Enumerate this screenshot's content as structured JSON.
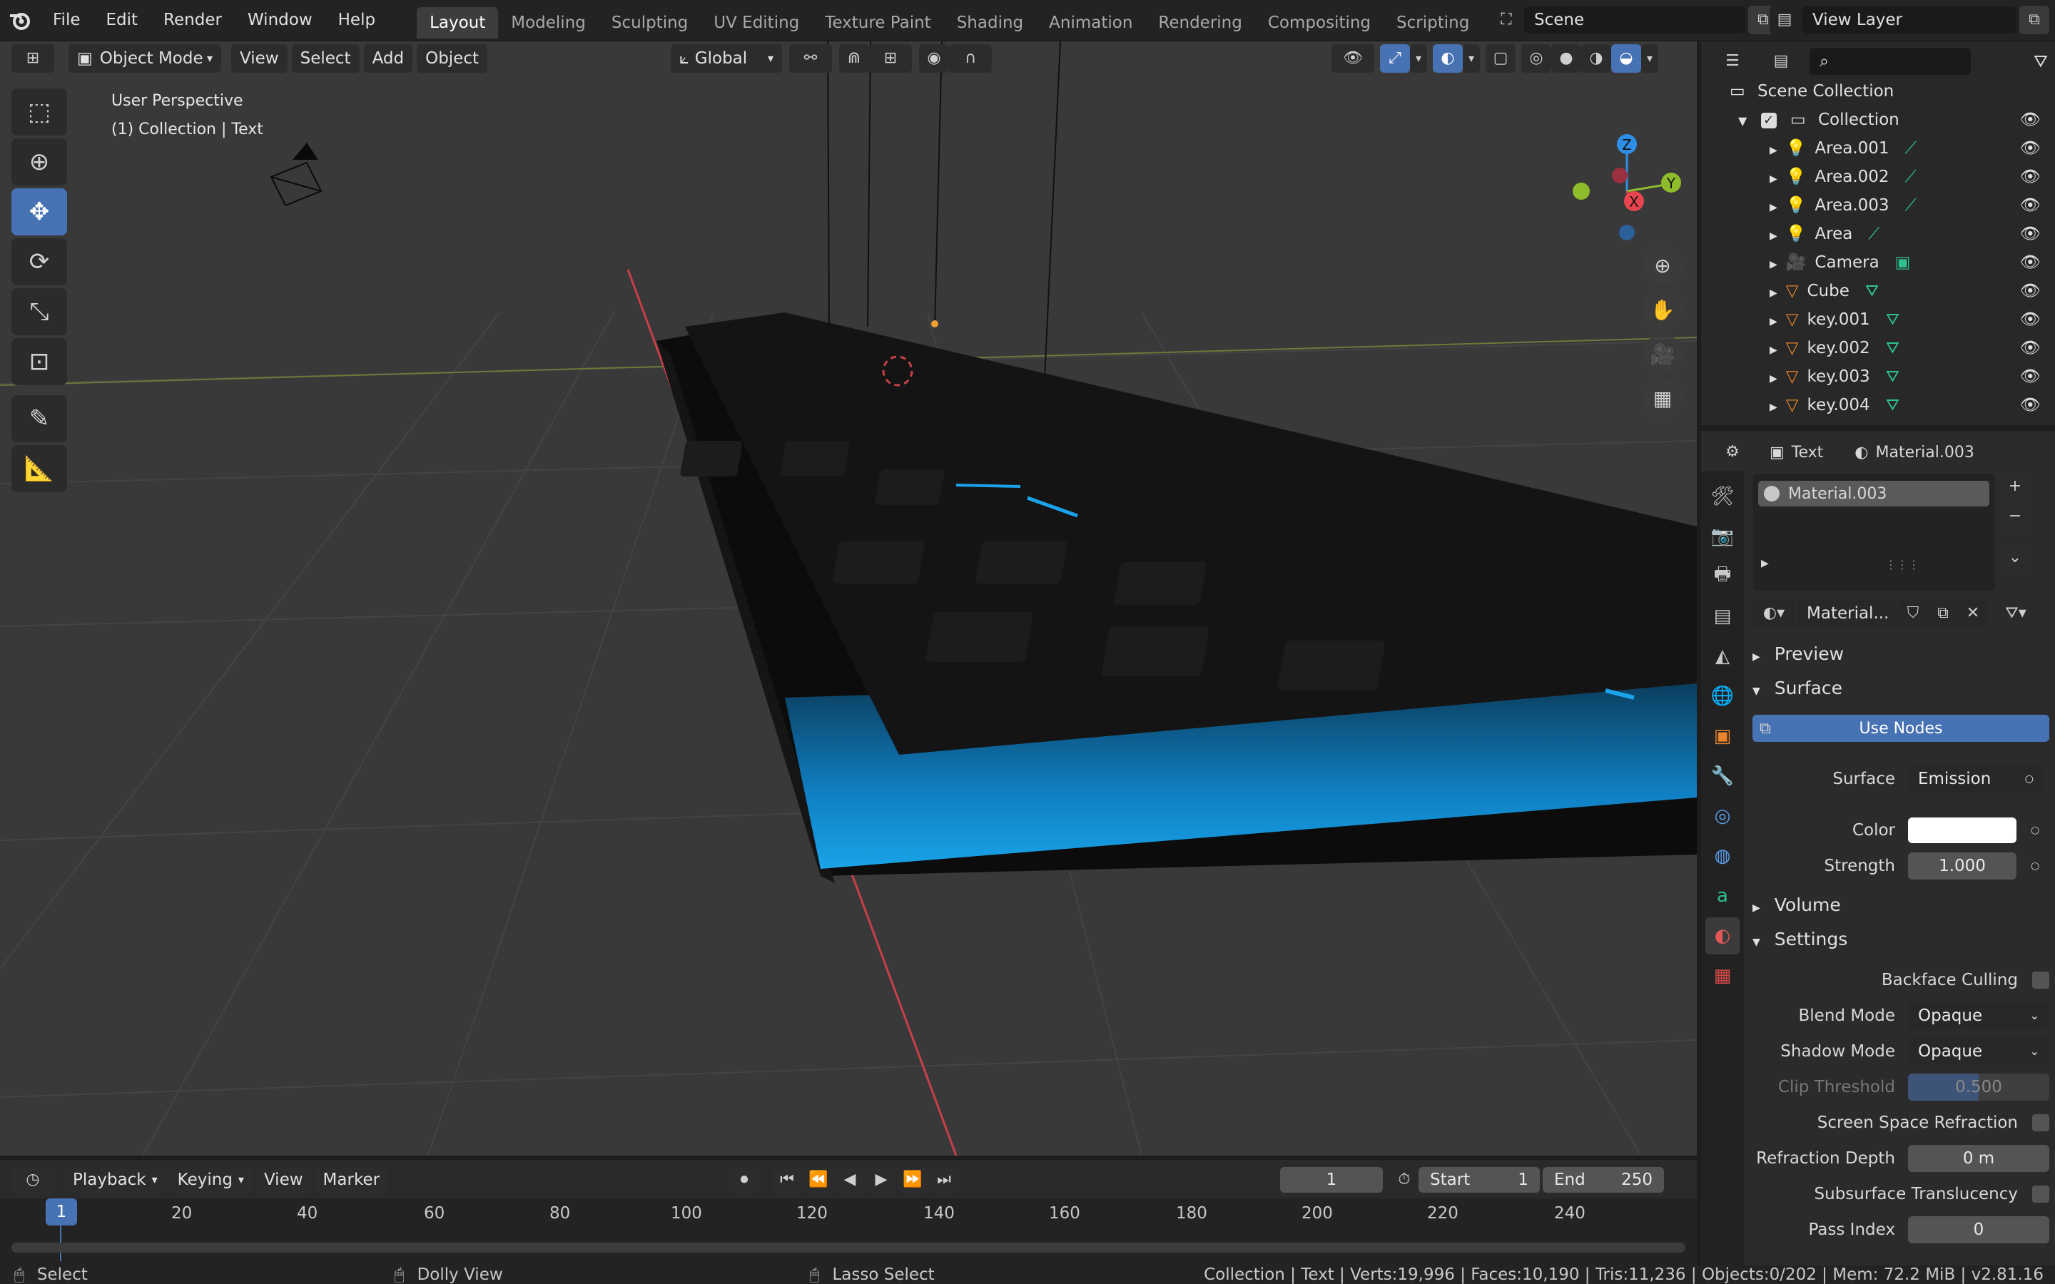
{
  "topbar": {
    "menus": [
      "File",
      "Edit",
      "Render",
      "Window",
      "Help"
    ],
    "workspaces": [
      "Layout",
      "Modeling",
      "Sculpting",
      "UV Editing",
      "Texture Paint",
      "Shading",
      "Animation",
      "Rendering",
      "Compositing",
      "Scripting"
    ],
    "active_workspace": "Layout",
    "scene_name": "Scene",
    "view_layer": "View Layer"
  },
  "viewport": {
    "mode": "Object Mode",
    "menus": [
      "View",
      "Select",
      "Add",
      "Object"
    ],
    "orientation": "Global",
    "overlay_line1": "User Perspective",
    "overlay_line2": "(1) Collection | Text",
    "gizmo": {
      "x": "X",
      "y": "Y",
      "z": "Z"
    }
  },
  "timeline": {
    "menus": [
      "Playback",
      "Keying",
      "View",
      "Marker"
    ],
    "current_frame": "1",
    "start_label": "Start",
    "start": "1",
    "end_label": "End",
    "end": "250",
    "ticks": [
      "1",
      "20",
      "40",
      "60",
      "80",
      "100",
      "120",
      "140",
      "160",
      "180",
      "200",
      "220",
      "240"
    ]
  },
  "outliner": {
    "root": "Scene Collection",
    "collection": "Collection",
    "items": [
      {
        "name": "Area.001",
        "type": "light"
      },
      {
        "name": "Area.002",
        "type": "light"
      },
      {
        "name": "Area.003",
        "type": "light"
      },
      {
        "name": "Area",
        "type": "light"
      },
      {
        "name": "Camera",
        "type": "camera"
      },
      {
        "name": "Cube",
        "type": "mesh"
      },
      {
        "name": "key.001",
        "type": "mesh"
      },
      {
        "name": "key.002",
        "type": "mesh"
      },
      {
        "name": "key.003",
        "type": "mesh"
      },
      {
        "name": "key.004",
        "type": "mesh"
      }
    ]
  },
  "properties": {
    "object_name": "Text",
    "material_name": "Material.003",
    "slot_name": "Material.003",
    "datablock_name": "Material...",
    "sections": {
      "preview": "Preview",
      "surface": "Surface",
      "volume": "Volume",
      "settings": "Settings"
    },
    "use_nodes": "Use Nodes",
    "surface_label": "Surface",
    "surface_value": "Emission",
    "color_label": "Color",
    "color_value": "#ffffff",
    "strength_label": "Strength",
    "strength_value": "1.000",
    "backface_label": "Backface Culling",
    "blend_mode_label": "Blend Mode",
    "blend_mode_value": "Opaque",
    "shadow_mode_label": "Shadow Mode",
    "shadow_mode_value": "Opaque",
    "clip_label": "Clip Threshold",
    "clip_value": "0.500",
    "ssr_label": "Screen Space Refraction",
    "refraction_depth_label": "Refraction Depth",
    "refraction_depth_value": "0 m",
    "sss_label": "Subsurface Translucency",
    "pass_index_label": "Pass Index",
    "pass_index_value": "0"
  },
  "statusbar": {
    "left_actions": [
      "Select",
      "Dolly View",
      "Lasso Select"
    ],
    "stats": "Collection | Text | Verts:19,996 | Faces:10,190 | Tris:11,236 | Objects:0/202 | Mem: 72.2 MiB | v2.81.16"
  },
  "colors": {
    "accent": "#4772b3",
    "glow": "#1aa3e8",
    "x_axis": "#e8454f",
    "y_axis": "#8fbc2b",
    "z_axis": "#2f8fe6"
  }
}
